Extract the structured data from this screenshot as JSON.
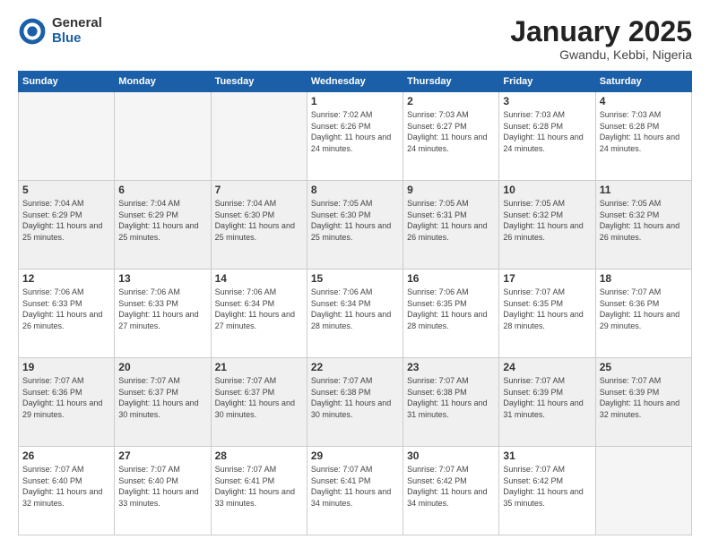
{
  "logo": {
    "general": "General",
    "blue": "Blue"
  },
  "title": "January 2025",
  "location": "Gwandu, Kebbi, Nigeria",
  "days_of_week": [
    "Sunday",
    "Monday",
    "Tuesday",
    "Wednesday",
    "Thursday",
    "Friday",
    "Saturday"
  ],
  "weeks": [
    [
      {
        "day": "",
        "empty": true
      },
      {
        "day": "",
        "empty": true
      },
      {
        "day": "",
        "empty": true
      },
      {
        "day": "1",
        "sunrise": "7:02 AM",
        "sunset": "6:26 PM",
        "daylight": "11 hours and 24 minutes."
      },
      {
        "day": "2",
        "sunrise": "7:03 AM",
        "sunset": "6:27 PM",
        "daylight": "11 hours and 24 minutes."
      },
      {
        "day": "3",
        "sunrise": "7:03 AM",
        "sunset": "6:28 PM",
        "daylight": "11 hours and 24 minutes."
      },
      {
        "day": "4",
        "sunrise": "7:03 AM",
        "sunset": "6:28 PM",
        "daylight": "11 hours and 24 minutes."
      }
    ],
    [
      {
        "day": "5",
        "sunrise": "7:04 AM",
        "sunset": "6:29 PM",
        "daylight": "11 hours and 25 minutes."
      },
      {
        "day": "6",
        "sunrise": "7:04 AM",
        "sunset": "6:29 PM",
        "daylight": "11 hours and 25 minutes."
      },
      {
        "day": "7",
        "sunrise": "7:04 AM",
        "sunset": "6:30 PM",
        "daylight": "11 hours and 25 minutes."
      },
      {
        "day": "8",
        "sunrise": "7:05 AM",
        "sunset": "6:30 PM",
        "daylight": "11 hours and 25 minutes."
      },
      {
        "day": "9",
        "sunrise": "7:05 AM",
        "sunset": "6:31 PM",
        "daylight": "11 hours and 26 minutes."
      },
      {
        "day": "10",
        "sunrise": "7:05 AM",
        "sunset": "6:32 PM",
        "daylight": "11 hours and 26 minutes."
      },
      {
        "day": "11",
        "sunrise": "7:05 AM",
        "sunset": "6:32 PM",
        "daylight": "11 hours and 26 minutes."
      }
    ],
    [
      {
        "day": "12",
        "sunrise": "7:06 AM",
        "sunset": "6:33 PM",
        "daylight": "11 hours and 26 minutes."
      },
      {
        "day": "13",
        "sunrise": "7:06 AM",
        "sunset": "6:33 PM",
        "daylight": "11 hours and 27 minutes."
      },
      {
        "day": "14",
        "sunrise": "7:06 AM",
        "sunset": "6:34 PM",
        "daylight": "11 hours and 27 minutes."
      },
      {
        "day": "15",
        "sunrise": "7:06 AM",
        "sunset": "6:34 PM",
        "daylight": "11 hours and 28 minutes."
      },
      {
        "day": "16",
        "sunrise": "7:06 AM",
        "sunset": "6:35 PM",
        "daylight": "11 hours and 28 minutes."
      },
      {
        "day": "17",
        "sunrise": "7:07 AM",
        "sunset": "6:35 PM",
        "daylight": "11 hours and 28 minutes."
      },
      {
        "day": "18",
        "sunrise": "7:07 AM",
        "sunset": "6:36 PM",
        "daylight": "11 hours and 29 minutes."
      }
    ],
    [
      {
        "day": "19",
        "sunrise": "7:07 AM",
        "sunset": "6:36 PM",
        "daylight": "11 hours and 29 minutes."
      },
      {
        "day": "20",
        "sunrise": "7:07 AM",
        "sunset": "6:37 PM",
        "daylight": "11 hours and 30 minutes."
      },
      {
        "day": "21",
        "sunrise": "7:07 AM",
        "sunset": "6:37 PM",
        "daylight": "11 hours and 30 minutes."
      },
      {
        "day": "22",
        "sunrise": "7:07 AM",
        "sunset": "6:38 PM",
        "daylight": "11 hours and 30 minutes."
      },
      {
        "day": "23",
        "sunrise": "7:07 AM",
        "sunset": "6:38 PM",
        "daylight": "11 hours and 31 minutes."
      },
      {
        "day": "24",
        "sunrise": "7:07 AM",
        "sunset": "6:39 PM",
        "daylight": "11 hours and 31 minutes."
      },
      {
        "day": "25",
        "sunrise": "7:07 AM",
        "sunset": "6:39 PM",
        "daylight": "11 hours and 32 minutes."
      }
    ],
    [
      {
        "day": "26",
        "sunrise": "7:07 AM",
        "sunset": "6:40 PM",
        "daylight": "11 hours and 32 minutes."
      },
      {
        "day": "27",
        "sunrise": "7:07 AM",
        "sunset": "6:40 PM",
        "daylight": "11 hours and 33 minutes."
      },
      {
        "day": "28",
        "sunrise": "7:07 AM",
        "sunset": "6:41 PM",
        "daylight": "11 hours and 33 minutes."
      },
      {
        "day": "29",
        "sunrise": "7:07 AM",
        "sunset": "6:41 PM",
        "daylight": "11 hours and 34 minutes."
      },
      {
        "day": "30",
        "sunrise": "7:07 AM",
        "sunset": "6:42 PM",
        "daylight": "11 hours and 34 minutes."
      },
      {
        "day": "31",
        "sunrise": "7:07 AM",
        "sunset": "6:42 PM",
        "daylight": "11 hours and 35 minutes."
      },
      {
        "day": "",
        "empty": true
      }
    ]
  ]
}
